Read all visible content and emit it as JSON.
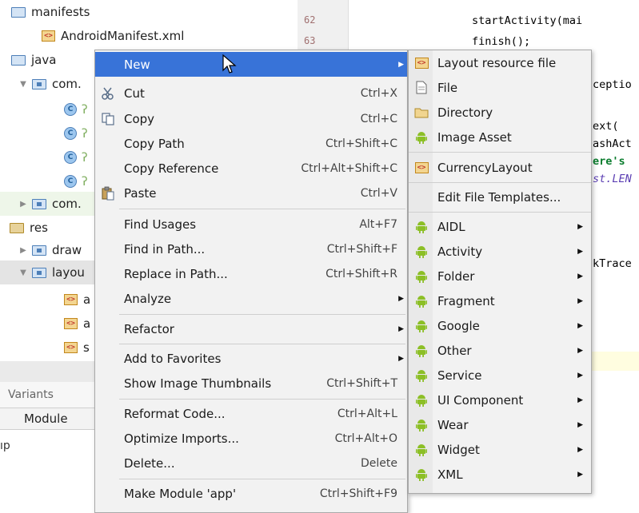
{
  "project_tree": {
    "rows": [
      {
        "label": "manifests",
        "kind": "folder",
        "arrow": ""
      },
      {
        "label": "AndroidManifest.xml",
        "kind": "xml"
      },
      {
        "label": "java",
        "kind": "folder",
        "arrow": ""
      },
      {
        "label": "com.",
        "kind": "pkg",
        "arrow": "▼"
      },
      {
        "label": "ʔ",
        "kind": "class"
      },
      {
        "label": "ʔ",
        "kind": "class"
      },
      {
        "label": "ʔ",
        "kind": "class"
      },
      {
        "label": "ʔ",
        "kind": "class"
      },
      {
        "label": "com.",
        "kind": "pkg",
        "arrow": "▶"
      },
      {
        "label": "res",
        "kind": "res",
        "arrow": ""
      },
      {
        "label": "draw",
        "kind": "pkg",
        "arrow": "▶"
      },
      {
        "label": "layou",
        "kind": "pkg",
        "arrow": "▼"
      },
      {
        "label": "a",
        "kind": "xml"
      },
      {
        "label": "a",
        "kind": "xml"
      },
      {
        "label": "s",
        "kind": "xml"
      }
    ],
    "variants_label": "Variants",
    "module_header": "Module",
    "module_value": "ıp"
  },
  "editor": {
    "line_numbers": [
      "62",
      "63"
    ],
    "code_lines": [
      {
        "text": "startActivity(mai",
        "style": "plain"
      },
      {
        "text": "finish();",
        "style": "plain"
      },
      {
        "text": "ceptio",
        "style": "plain"
      },
      {
        "text": "ext(",
        "style": "plain"
      },
      {
        "text": "ashAct",
        "style": "plain"
      },
      {
        "text": "ere's ",
        "style": "green"
      },
      {
        "text": "st.LEN",
        "style": "blue"
      },
      {
        "text": "kTrace",
        "style": "plain"
      }
    ]
  },
  "context_menu": {
    "items": [
      {
        "label": "New",
        "shortcut": "",
        "icon": "",
        "submenu": true,
        "active": true
      },
      {
        "label": "Cut",
        "shortcut": "Ctrl+X",
        "icon": "scissors-icon"
      },
      {
        "label": "Copy",
        "shortcut": "Ctrl+C",
        "icon": "copy-icon"
      },
      {
        "label": "Copy Path",
        "shortcut": "Ctrl+Shift+C",
        "icon": ""
      },
      {
        "label": "Copy Reference",
        "shortcut": "Ctrl+Alt+Shift+C",
        "icon": ""
      },
      {
        "label": "Paste",
        "shortcut": "Ctrl+V",
        "icon": "paste-icon"
      },
      {
        "label": "Find Usages",
        "shortcut": "Alt+F7",
        "icon": ""
      },
      {
        "label": "Find in Path...",
        "shortcut": "Ctrl+Shift+F",
        "icon": ""
      },
      {
        "label": "Replace in Path...",
        "shortcut": "Ctrl+Shift+R",
        "icon": ""
      },
      {
        "label": "Analyze",
        "shortcut": "",
        "icon": "",
        "submenu": true
      },
      {
        "label": "Refactor",
        "shortcut": "",
        "icon": "",
        "submenu": true
      },
      {
        "label": "Add to Favorites",
        "shortcut": "",
        "icon": "",
        "submenu": true
      },
      {
        "label": "Show Image Thumbnails",
        "shortcut": "Ctrl+Shift+T",
        "icon": ""
      },
      {
        "label": "Reformat Code...",
        "shortcut": "Ctrl+Alt+L",
        "icon": ""
      },
      {
        "label": "Optimize Imports...",
        "shortcut": "Ctrl+Alt+O",
        "icon": ""
      },
      {
        "label": "Delete...",
        "shortcut": "Delete",
        "icon": ""
      },
      {
        "label": "Make Module 'app'",
        "shortcut": "Ctrl+Shift+F9",
        "icon": ""
      }
    ]
  },
  "submenu": {
    "items": [
      {
        "label": "Layout resource file",
        "icon": "layout-file-icon"
      },
      {
        "label": "File",
        "icon": "file-icon"
      },
      {
        "label": "Directory",
        "icon": "folder-icon"
      },
      {
        "label": "Image Asset",
        "icon": "android-icon"
      },
      {
        "label": "CurrencyLayout",
        "icon": "layout-file-icon"
      },
      {
        "label": "Edit File Templates...",
        "icon": ""
      },
      {
        "label": "AIDL",
        "icon": "android-icon",
        "submenu": true
      },
      {
        "label": "Activity",
        "icon": "android-icon",
        "submenu": true
      },
      {
        "label": "Folder",
        "icon": "android-icon",
        "submenu": true
      },
      {
        "label": "Fragment",
        "icon": "android-icon",
        "submenu": true
      },
      {
        "label": "Google",
        "icon": "android-icon",
        "submenu": true
      },
      {
        "label": "Other",
        "icon": "android-icon",
        "submenu": true
      },
      {
        "label": "Service",
        "icon": "android-icon",
        "submenu": true
      },
      {
        "label": "UI Component",
        "icon": "android-icon",
        "submenu": true
      },
      {
        "label": "Wear",
        "icon": "android-icon",
        "submenu": true
      },
      {
        "label": "Widget",
        "icon": "android-icon",
        "submenu": true
      },
      {
        "label": "XML",
        "icon": "android-icon",
        "submenu": true
      }
    ]
  },
  "colors": {
    "menu_highlight": "#3873d8",
    "android_green": "#8cbf26"
  }
}
